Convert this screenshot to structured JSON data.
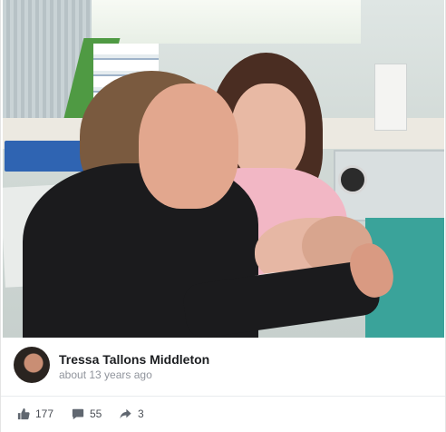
{
  "post": {
    "author_name": "Tressa Tallons Middleton",
    "timestamp": "about 13 years ago",
    "stats": {
      "likes": "177",
      "comments": "55",
      "shares": "3"
    }
  },
  "icons": {
    "likes": "thumbs-up-icon",
    "comments": "comment-icon",
    "shares": "share-arrow-icon"
  },
  "colors": {
    "name_text": "#1c1e21",
    "meta_text": "#90949c",
    "stat_text": "#4b4f56",
    "icon": "#606770"
  }
}
